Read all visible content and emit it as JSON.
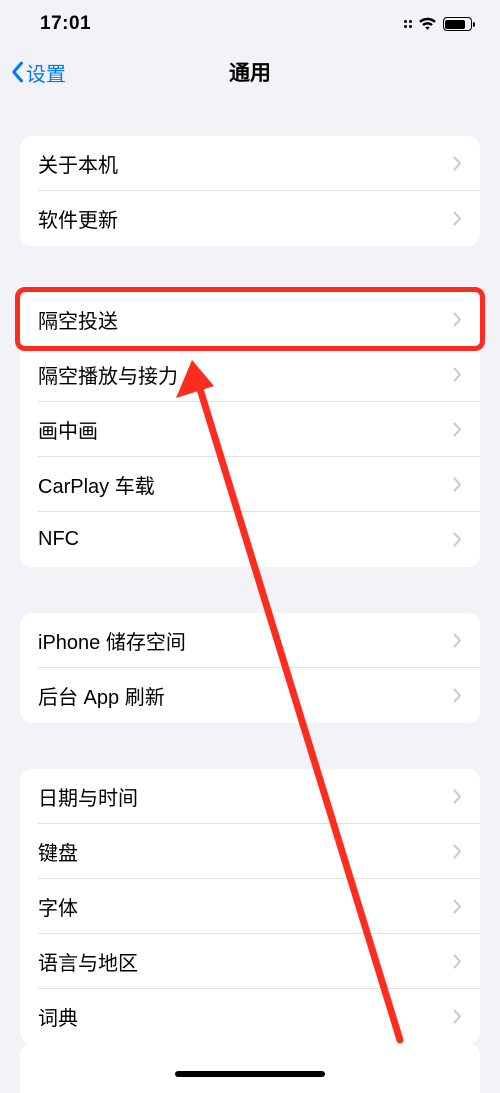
{
  "status": {
    "time": "17:01"
  },
  "nav": {
    "back_label": "设置",
    "title": "通用"
  },
  "group1": {
    "items": [
      {
        "label": "关于本机"
      },
      {
        "label": "软件更新"
      }
    ]
  },
  "group2": {
    "items": [
      {
        "label": "隔空投送"
      },
      {
        "label": "隔空播放与接力"
      },
      {
        "label": "画中画"
      },
      {
        "label": "CarPlay 车载"
      },
      {
        "label": "NFC"
      }
    ]
  },
  "group3": {
    "items": [
      {
        "label": "iPhone 储存空间"
      },
      {
        "label": "后台 App 刷新"
      }
    ]
  },
  "group4": {
    "items": [
      {
        "label": "日期与时间"
      },
      {
        "label": "键盘"
      },
      {
        "label": "字体"
      },
      {
        "label": "语言与地区"
      },
      {
        "label": "词典"
      }
    ]
  },
  "annotation": {
    "highlight_color": "#fc2c1f"
  }
}
